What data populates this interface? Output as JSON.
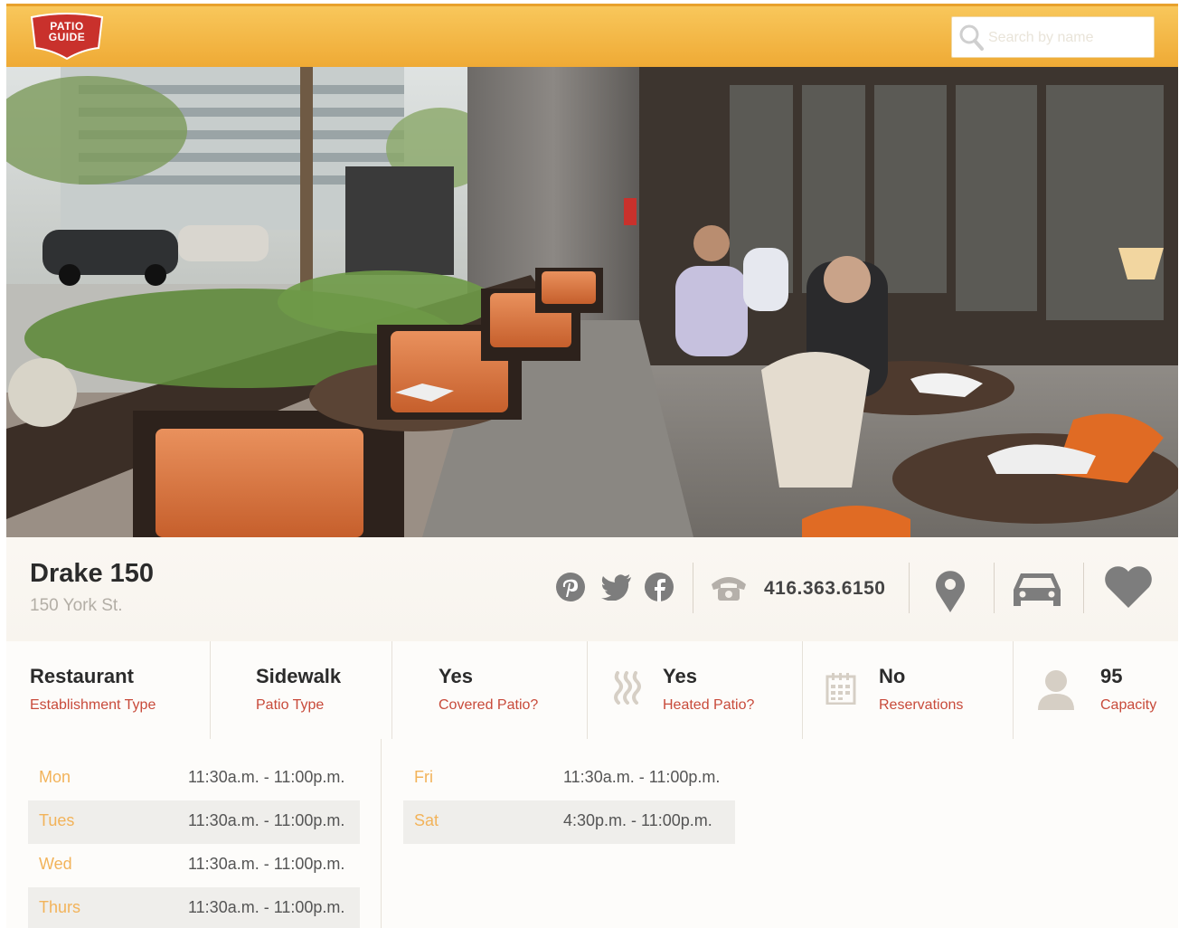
{
  "header": {
    "logo_text": [
      "PATIO",
      "GUIDE"
    ],
    "search_placeholder": "Search by name"
  },
  "restaurant": {
    "name": "Drake 150",
    "address": "150 York St.",
    "phone": "416.363.6150"
  },
  "icons": {
    "social": [
      "pinterest-icon",
      "twitter-icon",
      "facebook-icon"
    ],
    "phone": "phone-icon",
    "map": "map-pin-icon",
    "car": "car-icon",
    "favorite": "heart-icon"
  },
  "attributes": [
    {
      "value": "Restaurant",
      "label": "Establishment Type",
      "icon": null
    },
    {
      "value": "Sidewalk",
      "label": "Patio Type",
      "icon": null
    },
    {
      "value": "Yes",
      "label": "Covered Patio?",
      "icon": null
    },
    {
      "value": "Yes",
      "label": "Heated Patio?",
      "icon": "heat-waves-icon"
    },
    {
      "value": "No",
      "label": "Reservations",
      "icon": "calendar-icon"
    },
    {
      "value": "95",
      "label": "Capacity",
      "icon": "person-icon"
    }
  ],
  "hours": {
    "left": [
      {
        "day": "Mon",
        "time": "11:30a.m. - 11:00p.m."
      },
      {
        "day": "Tues",
        "time": "11:30a.m. - 11:00p.m."
      },
      {
        "day": "Wed",
        "time": "11:30a.m. - 11:00p.m."
      },
      {
        "day": "Thurs",
        "time": "11:30a.m. - 11:00p.m."
      }
    ],
    "right": [
      {
        "day": "Fri",
        "time": "11:30a.m. - 11:00p.m."
      },
      {
        "day": "Sat",
        "time": "4:30p.m. - 11:00p.m."
      }
    ]
  },
  "colors": {
    "header": "#f4b947",
    "logo": "#c9312c",
    "label_red": "#c84a3a",
    "day_orange": "#f2b35a",
    "icon_gray": "#7d7d7d"
  }
}
